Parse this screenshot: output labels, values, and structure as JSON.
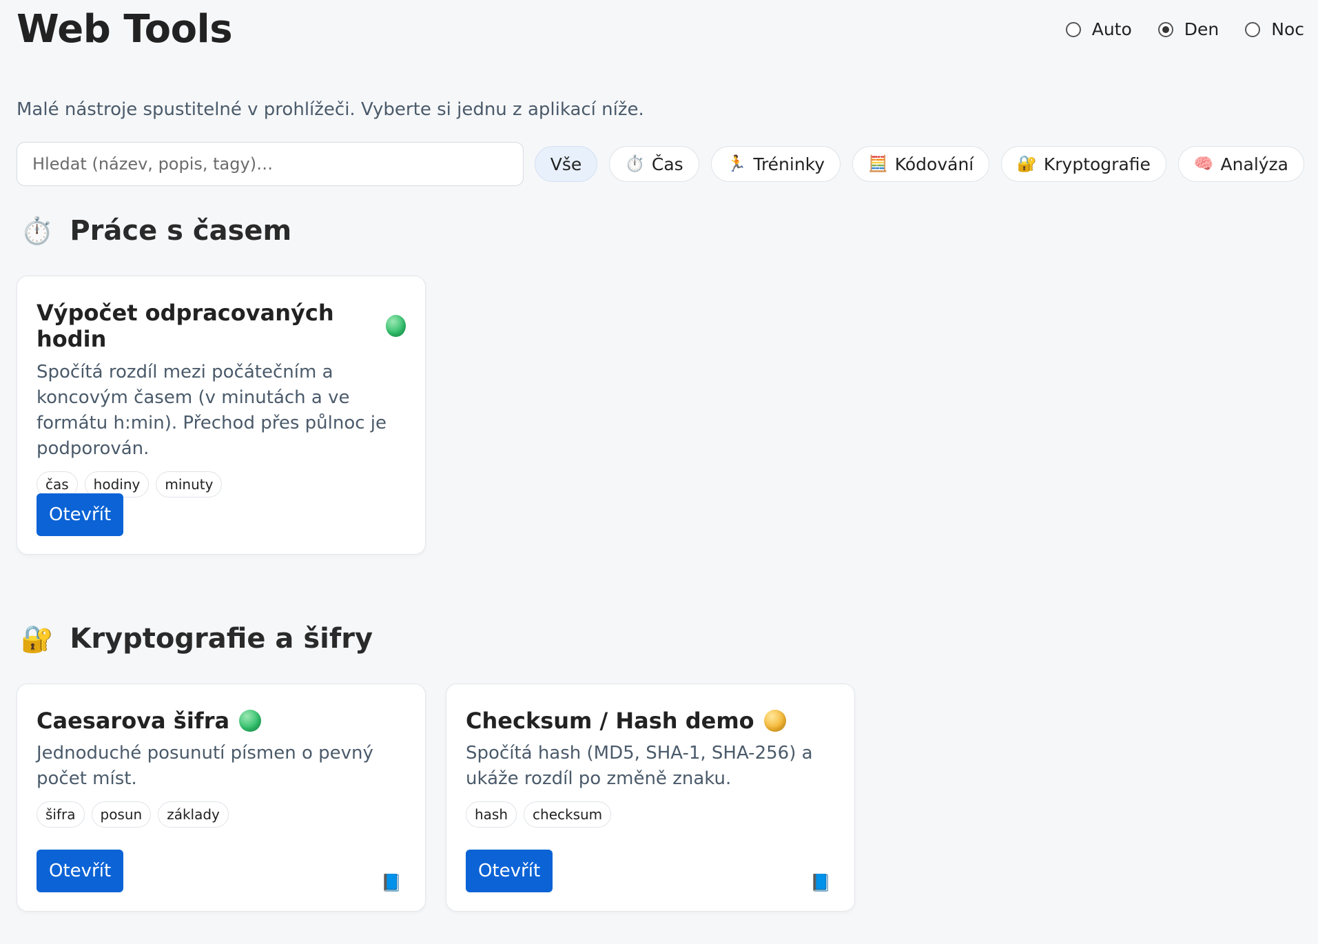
{
  "header": {
    "title": "Web Tools",
    "theme_options": [
      {
        "label": "Auto",
        "checked": false
      },
      {
        "label": "Den",
        "checked": true
      },
      {
        "label": "Noc",
        "checked": false
      }
    ]
  },
  "subtitle": "Malé nástroje spustitelné v prohlížeči. Vyberte si jednu z aplikací níže.",
  "search": {
    "placeholder": "Hledat (název, popis, tagy)…",
    "value": ""
  },
  "filters": [
    {
      "label": "Vše",
      "icon": "",
      "active": true
    },
    {
      "label": "Čas",
      "icon": "⏱️",
      "active": false
    },
    {
      "label": "Tréninky",
      "icon": "🏃",
      "active": false
    },
    {
      "label": "Kódování",
      "icon": "🧮",
      "active": false
    },
    {
      "label": "Kryptografie",
      "icon": "🔐",
      "active": false
    },
    {
      "label": "Analýza",
      "icon": "🧠",
      "active": false
    }
  ],
  "sections": [
    {
      "icon": "⏱️",
      "title": "Práce s časem",
      "cards": [
        {
          "title": "Výpočet odpracovaných hodin",
          "status": "green",
          "description": "Spočítá rozdíl mezi počátečním a koncovým časem (v minutách a ve formátu h:min). Přechod přes půlnoc je podporován.",
          "tags": [
            "čas",
            "hodiny",
            "minuty"
          ],
          "button_label": "Otevřít",
          "has_docs": false
        }
      ]
    },
    {
      "icon": "🔐",
      "title": "Kryptografie a šifry",
      "cards": [
        {
          "title": "Caesarova šifra",
          "status": "green",
          "description": "Jednoduché posunutí písmen o pevný počet míst.",
          "tags": [
            "šifra",
            "posun",
            "základy"
          ],
          "button_label": "Otevřít",
          "has_docs": true,
          "docs_icon": "📘"
        },
        {
          "title": "Checksum / Hash demo",
          "status": "yellow",
          "description": "Spočítá hash (MD5, SHA-1, SHA-256) a ukáže rozdíl po změně znaku.",
          "tags": [
            "hash",
            "checksum"
          ],
          "button_label": "Otevřít",
          "has_docs": true,
          "docs_icon": "📘"
        }
      ]
    }
  ]
}
